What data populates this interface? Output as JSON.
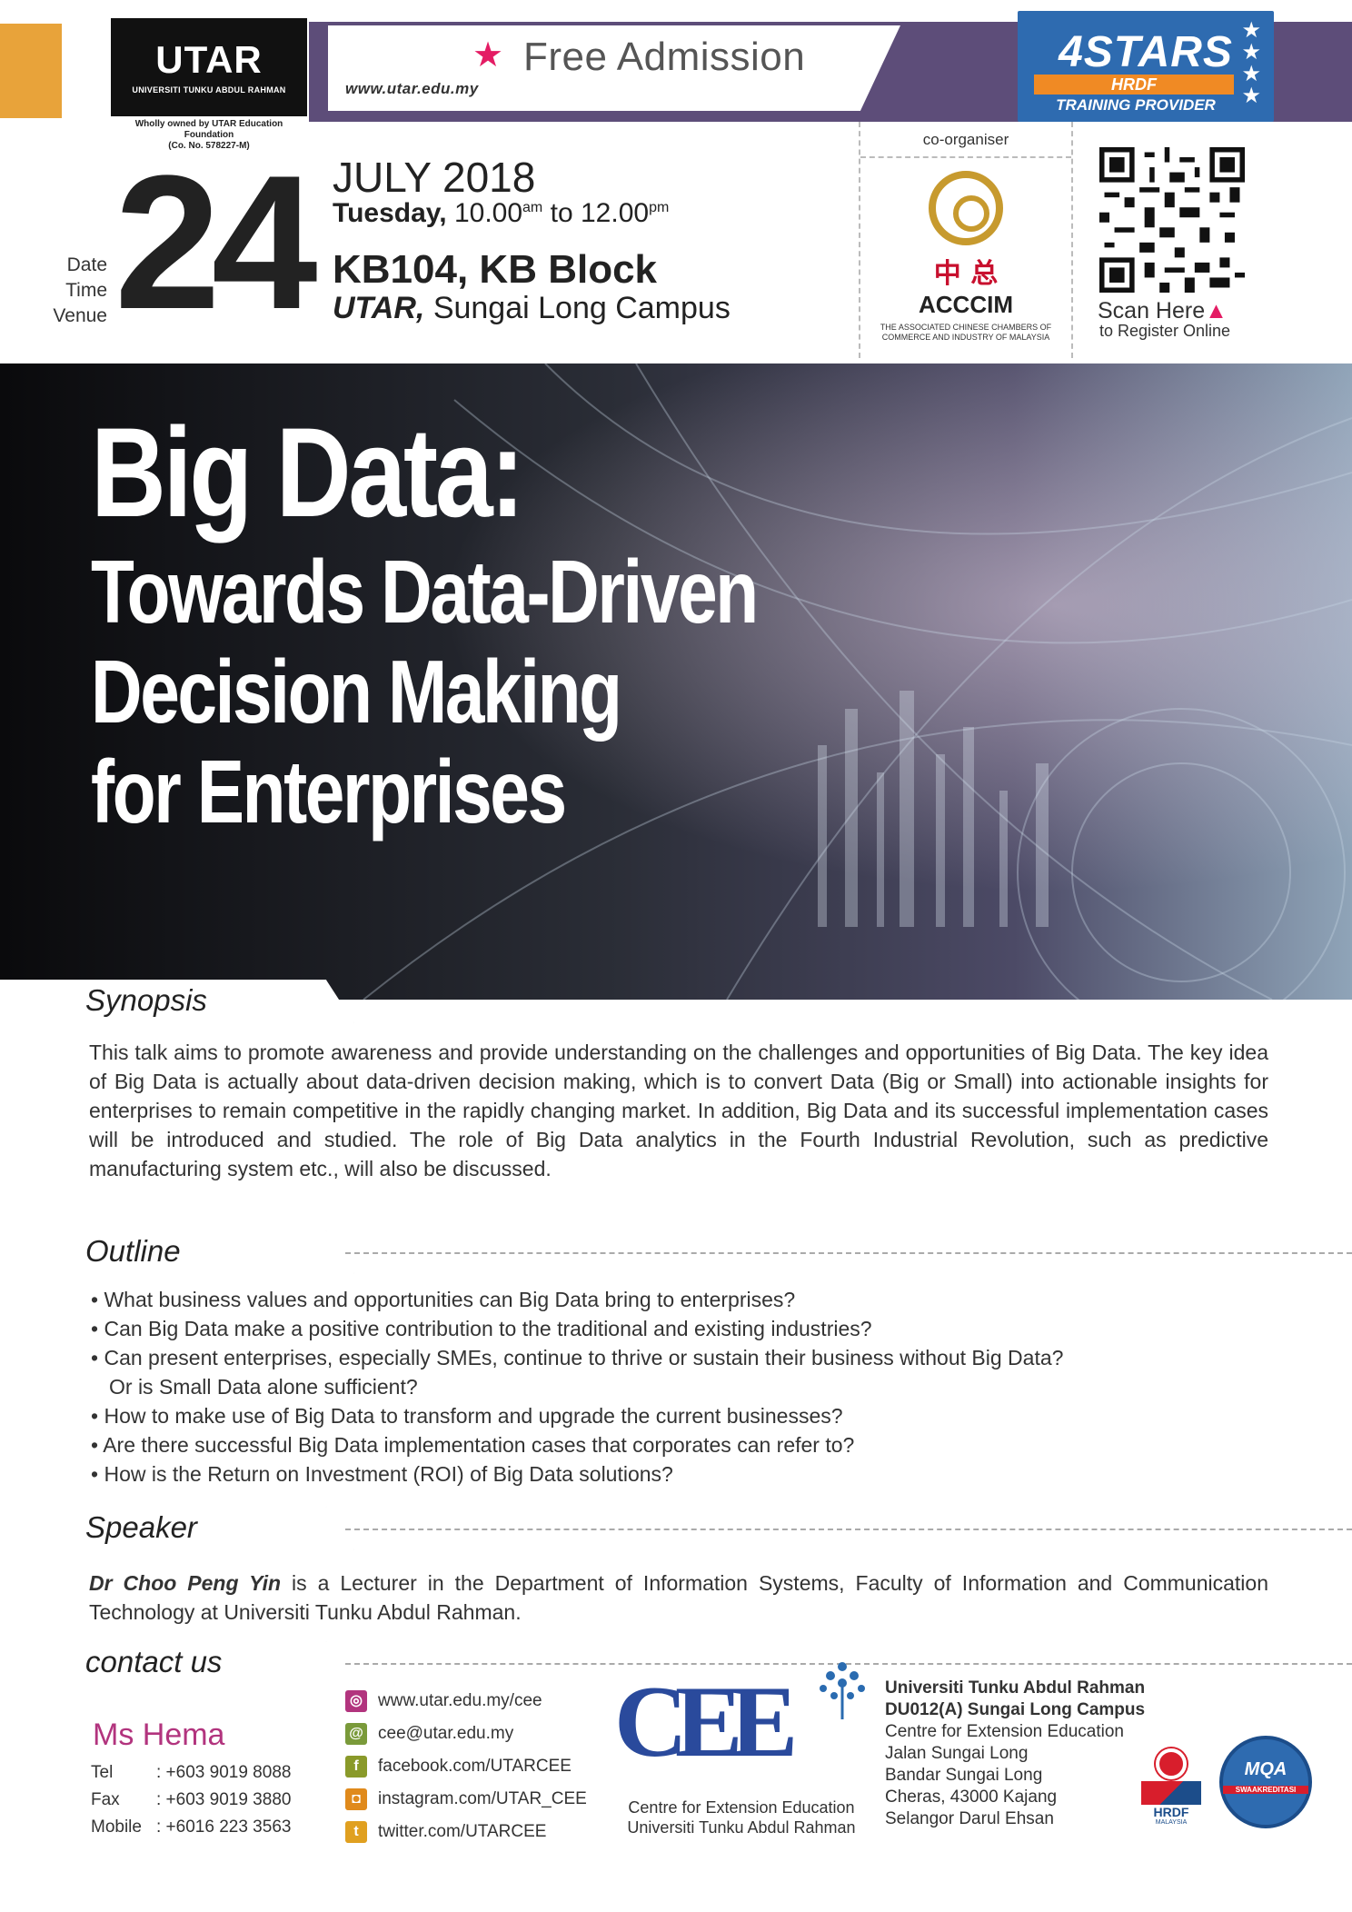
{
  "header": {
    "utar_logo_text": "UTAR",
    "utar_logo_sub": "UNIVERSITI TUNKU ABDUL RAHMAN",
    "owned_by": "Wholly owned by UTAR Education Foundation",
    "company_no": "(Co. No. 578227-M)",
    "admission": "Free Admission",
    "website": "www.utar.edu.my",
    "badge_top": "4STARS",
    "badge_mid": "HRDF",
    "badge_bottom": "TRAINING PROVIDER"
  },
  "event": {
    "labels": [
      "Date",
      "Time",
      "Venue"
    ],
    "day": "24",
    "month_year": "JULY 2018",
    "weekday": "Tuesday,",
    "time_start": "10.00",
    "time_start_suffix": "am",
    "time_to": "to",
    "time_end": "12.00",
    "time_end_suffix": "pm",
    "venue_room": "KB104, KB Block",
    "venue_uni": "UTAR,",
    "venue_campus": "Sungai Long Campus"
  },
  "coorganiser": {
    "label": "co-organiser",
    "chinese": "中 总",
    "name": "ACCCIM",
    "full_name_1": "THE ASSOCIATED CHINESE CHAMBERS OF",
    "full_name_2": "COMMERCE AND INDUSTRY OF MALAYSIA"
  },
  "register": {
    "scan": "Scan Here",
    "sub": "to Register Online"
  },
  "hero": {
    "title_1": "Big Data:",
    "title_2": "Towards Data-Driven",
    "title_3": "Decision Making",
    "title_4": "for Enterprises"
  },
  "synopsis": {
    "heading": "Synopsis",
    "text": "This talk aims to promote awareness and provide understanding on the challenges and opportunities of Big Data. The key idea of Big Data is actually about data-driven decision making, which is to convert Data (Big or Small) into actionable insights for enterprises to remain competitive in the rapidly changing market. In addition, Big Data and its successful implementation cases will be introduced and studied. The role of Big Data analytics in the Fourth Industrial Revolution, such as predictive manufacturing system etc., will also be discussed."
  },
  "outline": {
    "heading": "Outline",
    "items": [
      "What business values and opportunities can Big Data bring to enterprises?",
      "Can Big Data make a positive contribution to the traditional and existing industries?",
      "Can present enterprises, especially SMEs, continue to thrive or sustain their business without Big Data?",
      "How to make use of Big Data to transform and upgrade the current businesses?",
      "Are there successful Big Data implementation cases that corporates can refer to?",
      "How is the Return on Investment (ROI) of Big Data solutions?"
    ],
    "item_3_cont": "Or is Small Data alone sufficient?"
  },
  "speaker": {
    "heading": "Speaker",
    "name": "Dr Choo Peng Yin",
    "text": " is a Lecturer in the Department of Information Systems, Faculty of Information and Communication Technology at Universiti Tunku Abdul Rahman."
  },
  "contact": {
    "heading": "contact us",
    "person": "Ms Hema",
    "tel_label": "Tel",
    "tel": ": +603 9019 8088",
    "fax_label": "Fax",
    "fax": ": +603 9019 3880",
    "mobile_label": "Mobile",
    "mobile": ": +6016 223 3563",
    "links": [
      {
        "icon": "web-icon",
        "text": "www.utar.edu.my/cee",
        "color": "#b2347e"
      },
      {
        "icon": "email-icon",
        "text": "cee@utar.edu.my",
        "color": "#7a9a3a"
      },
      {
        "icon": "facebook-icon",
        "text": "facebook.com/UTARCEE",
        "color": "#8a9a2a"
      },
      {
        "icon": "instagram-icon",
        "text": "instagram.com/UTAR_CEE",
        "color": "#e08a1c"
      },
      {
        "icon": "twitter-icon",
        "text": "twitter.com/UTARCEE",
        "color": "#e0a020"
      }
    ],
    "cee_logo": "CEE",
    "cee_sub_1": "Centre for Extension Education",
    "cee_sub_2": "Universiti Tunku Abdul Rahman",
    "address": [
      "Universiti Tunku Abdul Rahman",
      "DU012(A) Sungai Long Campus",
      "Centre for Extension Education",
      "Jalan Sungai Long",
      "Bandar Sungai Long",
      "Cheras, 43000 Kajang",
      "Selangor Darul Ehsan"
    ],
    "hrdf": "HRDF",
    "hrdf_sub": "MALAYSIA",
    "moa": "MQA",
    "moa_sub": "SWAAKREDITASI"
  },
  "colors": {
    "accent": "#e41c64",
    "purple": "#5d4d79",
    "orange": "#e8a33a",
    "blue": "#2e6bb0"
  }
}
